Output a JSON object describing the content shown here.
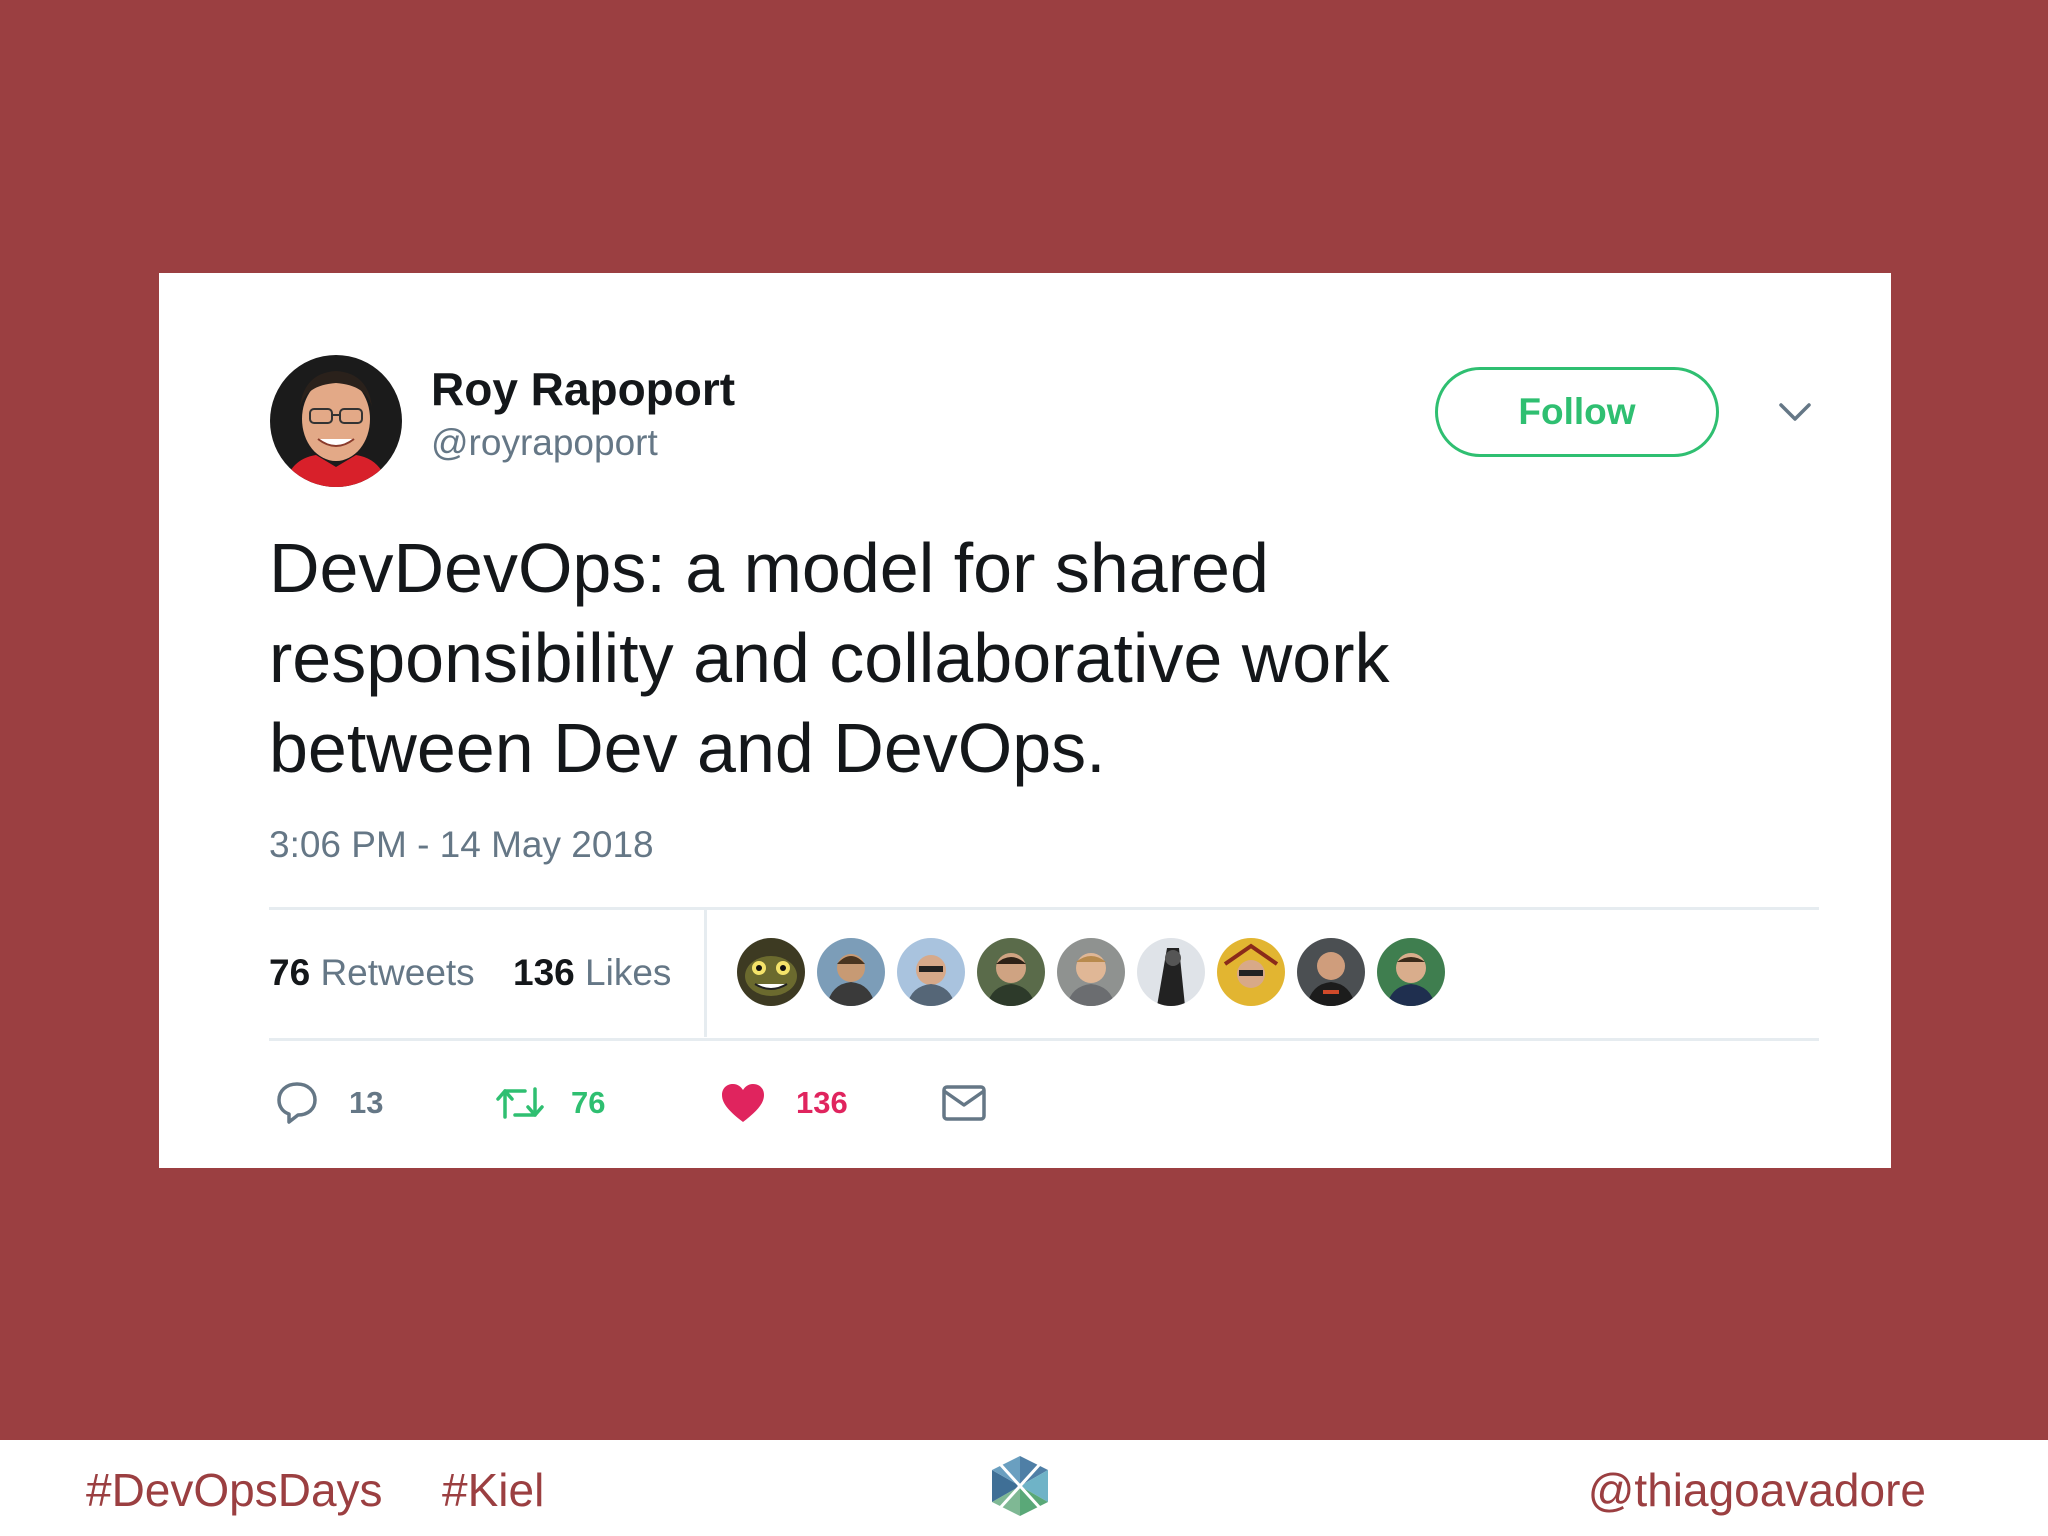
{
  "tweet": {
    "display_name": "Roy Rapoport",
    "screen_name": "@royrapoport",
    "follow_label": "Follow",
    "text": "DevDevOps: a model for shared responsibility and collaborative work between Dev and DevOps.",
    "timestamp": "3:06 PM - 14 May 2018",
    "stats": {
      "retweets_count": "76",
      "retweets_label": "Retweets",
      "likes_count": "136",
      "likes_label": "Likes"
    },
    "actions": {
      "reply_count": "13",
      "retweet_count": "76",
      "like_count": "136"
    }
  },
  "footer": {
    "hashtag_1": "#DevOpsDays",
    "hashtag_2": "#Kiel",
    "handle": "@thiagoavadore"
  },
  "colors": {
    "slide_background": "#9b3f41",
    "follow_green": "#2fbf71",
    "retweet_green": "#2fbf71",
    "like_red": "#e0245e",
    "muted_text": "#657786",
    "dark_text": "#14171a"
  }
}
